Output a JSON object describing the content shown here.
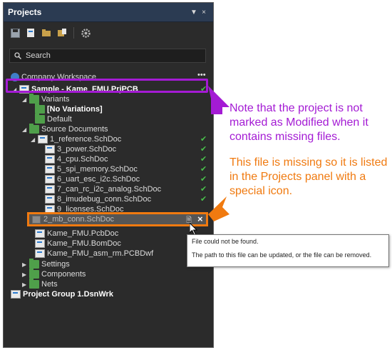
{
  "panel": {
    "title": "Projects",
    "header_buttons": [
      "▼",
      "×"
    ]
  },
  "search": {
    "label": "Search"
  },
  "tree": {
    "workspace": "Company Workspace",
    "project": "Sample - Kame_FMU.PrjPCB",
    "variants": "Variants",
    "no_variations": "[No Variations]",
    "default": "Default",
    "source_documents": "Source Documents",
    "reference": "1_reference.SchDoc",
    "sheets": [
      "3_power.SchDoc",
      "4_cpu.SchDoc",
      "5_spi_memory.SchDoc",
      "6_uart_esc_i2c.SchDoc",
      "7_can_rc_i2c_analog.SchDoc",
      "8_imudebug_conn.SchDoc",
      "9_licenses.SchDoc"
    ],
    "missing": "2_mb_conn.SchDoc",
    "pcb": "Kame_FMU.PcbDoc",
    "bom": "Kame_FMU.BomDoc",
    "pcbdwf": "Kame_FMU_asm_rm.PCBDwf",
    "settings": "Settings",
    "components": "Components",
    "nets": "Nets",
    "group": "Project Group 1.DsnWrk"
  },
  "callouts": {
    "purple": "Note that the project is not marked as Modified when it contains missing files.",
    "orange": "This file is missing so it is listed in the Projects panel with a special icon."
  },
  "tooltip": {
    "line1": "File could not be found.",
    "line2": "The path to this file can be updated, or the file can be removed."
  },
  "colors": {
    "panel_bg": "#2b2b2b",
    "header_bg": "#2b3b52",
    "purple": "#a41bd4",
    "orange": "#f07a10",
    "check": "#49c04b"
  }
}
